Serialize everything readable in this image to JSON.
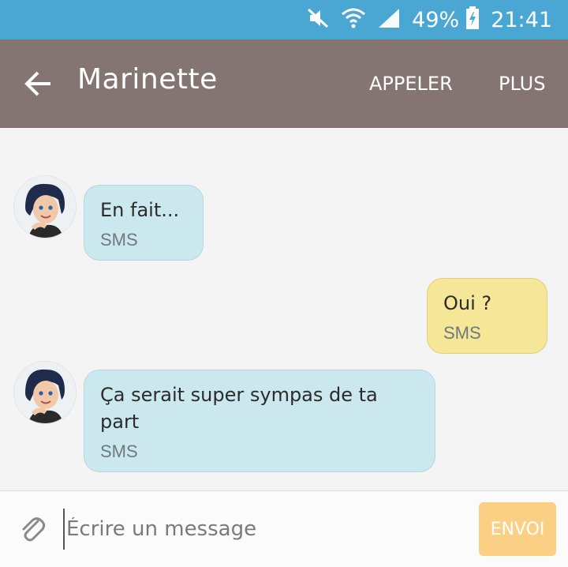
{
  "status_bar": {
    "battery_percent": "49%",
    "time": "21:41",
    "icons": [
      "mute-icon",
      "wifi-icon",
      "signal-icon",
      "battery-charging-icon"
    ],
    "background_color": "#4aa7d3"
  },
  "header": {
    "contact_name": "Marinette",
    "call_label": "APPELER",
    "more_label": "PLUS",
    "background_color": "#847572",
    "back_icon": "arrow-left-icon"
  },
  "messages": [
    {
      "direction": "incoming",
      "text": "En fait...",
      "meta": "SMS"
    },
    {
      "direction": "outgoing",
      "text": "Oui ?",
      "meta": "SMS"
    },
    {
      "direction": "incoming",
      "text": "Ça serait super sympas de ta part",
      "meta": "SMS"
    }
  ],
  "composer": {
    "placeholder": "Écrire un message",
    "send_label": "ENVOI",
    "attach_icon": "paperclip-icon"
  },
  "colors": {
    "incoming_bubble": "#cbe8ef",
    "outgoing_bubble": "#f6e698",
    "send_button": "#fbcf84"
  }
}
